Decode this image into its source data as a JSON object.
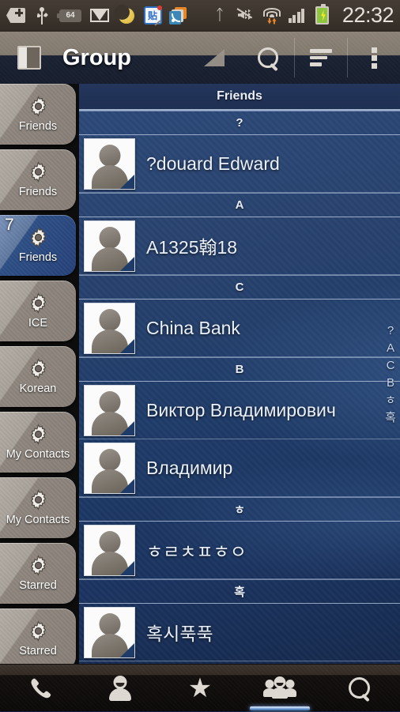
{
  "statusbar": {
    "time": "22:32",
    "left_icons": [
      {
        "name": "back-plus-icon",
        "label": "+"
      },
      {
        "name": "usb-icon",
        "label": "USB"
      },
      {
        "name": "battery-percent-icon",
        "label": "64"
      },
      {
        "name": "gmail-icon",
        "label": "M"
      },
      {
        "name": "moon-dnd-icon",
        "label": "moon"
      },
      {
        "name": "note-app-icon",
        "label": "贴"
      },
      {
        "name": "rss-feed-icon",
        "label": "rss"
      }
    ],
    "right_icons": [
      {
        "name": "bluetooth-icon",
        "label": "bluetooth"
      },
      {
        "name": "vibrate-mute-icon",
        "label": "mute"
      },
      {
        "name": "wifi-icon",
        "label": "wifi"
      },
      {
        "name": "signal-icon",
        "label": "signal"
      },
      {
        "name": "battery-charging-icon",
        "label": "battery"
      }
    ]
  },
  "actionbar": {
    "title": "Group",
    "panel_toggle": "panel-toggle",
    "spinner": "dropdown-triangle",
    "search": "search-icon",
    "sort": "sort-icon",
    "more": "overflow-menu-icon"
  },
  "sidebar": {
    "tabs": [
      {
        "label": "Friends",
        "selected": false,
        "badge": ""
      },
      {
        "label": "Friends",
        "selected": false,
        "badge": ""
      },
      {
        "label": "Friends",
        "selected": true,
        "badge": "7"
      },
      {
        "label": "ICE",
        "selected": false,
        "badge": ""
      },
      {
        "label": "Korean",
        "selected": false,
        "badge": ""
      },
      {
        "label": "My Contacts",
        "selected": false,
        "badge": ""
      },
      {
        "label": "My Contacts",
        "selected": false,
        "badge": ""
      },
      {
        "label": "Starred",
        "selected": false,
        "badge": ""
      },
      {
        "label": "Starred",
        "selected": false,
        "badge": ""
      }
    ]
  },
  "list": {
    "group_header": "Friends",
    "sections": [
      {
        "letter": "?",
        "contacts": [
          {
            "name": "?douard Edward"
          }
        ]
      },
      {
        "letter": "A",
        "contacts": [
          {
            "name": "A1325翰18"
          }
        ]
      },
      {
        "letter": "C",
        "contacts": [
          {
            "name": "China Bank"
          }
        ]
      },
      {
        "letter": "В",
        "contacts": [
          {
            "name": "Виктор Владимирович"
          },
          {
            "name": "Владимир"
          }
        ]
      },
      {
        "letter": "ㅎ",
        "contacts": [
          {
            "name": "ㅎㄹㅊㅍㅎㅇ"
          }
        ]
      },
      {
        "letter": "혹",
        "contacts": [
          {
            "name": "혹시푹푹"
          }
        ]
      }
    ]
  },
  "index_strip": [
    "?",
    "A",
    "C",
    "B",
    "ㅎ",
    "혹"
  ],
  "bottomnav": {
    "items": [
      {
        "label": "Phone",
        "icon": "phone-icon",
        "selected": false
      },
      {
        "label": "Contacts",
        "icon": "person-icon",
        "selected": false
      },
      {
        "label": "Favorites",
        "icon": "star-icon",
        "selected": false
      },
      {
        "label": "Groups",
        "icon": "groups-icon",
        "selected": true
      },
      {
        "label": "Search",
        "icon": "search-icon",
        "selected": false
      }
    ]
  },
  "colors": {
    "accent_blue": "#2d4f86",
    "list_bg": "#1f3b68",
    "actionbar_bg": "#161d2c",
    "statusbar_bg": "#3b342d",
    "nav_bg": "#0b0908"
  }
}
